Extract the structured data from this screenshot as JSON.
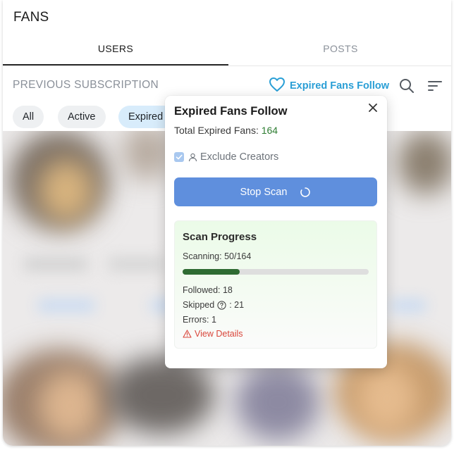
{
  "app": {
    "title": "FANS"
  },
  "tabs": [
    {
      "label": "USERS",
      "active": true
    },
    {
      "label": "POSTS",
      "active": false
    }
  ],
  "header": {
    "section_label": "PREVIOUS SUBSCRIPTION",
    "expired_follow_label": "Expired Fans Follow",
    "icons": [
      "heart-icon",
      "search-icon",
      "filter-icon"
    ]
  },
  "filters": {
    "chips": [
      {
        "label": "All",
        "selected": false
      },
      {
        "label": "Active",
        "selected": false
      },
      {
        "label": "Expired",
        "selected": true
      }
    ]
  },
  "popup": {
    "title": "Expired Fans Follow",
    "total_label": "Total Expired Fans:",
    "total_value": "164",
    "exclude_label": "Exclude Creators",
    "exclude_checked": true,
    "stop_button_label": "Stop Scan",
    "progress": {
      "title": "Scan Progress",
      "scanning_text": "Scanning: 50/164",
      "fraction": 0.305,
      "followed_text": "Followed: 18",
      "skipped_label": "Skipped",
      "skipped_value": ": 21",
      "errors_text": "Errors: 1",
      "view_details_label": "View Details"
    }
  },
  "colors": {
    "accent_blue": "#2a9fd6",
    "button_blue": "#5f8fdd",
    "progress_green": "#2e6b32",
    "error_red": "#d9463b",
    "count_green": "#2e7d32"
  }
}
